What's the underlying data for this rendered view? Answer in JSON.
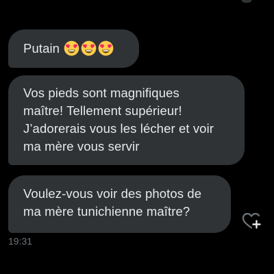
{
  "messages": [
    {
      "text": "Putain",
      "emojis": [
        "heart-eyes-emoji",
        "heart-eyes-emoji",
        "heart-eyes-emoji"
      ]
    },
    {
      "lines": [
        "Vos pieds sont magnifiques",
        "maître! Tellement supérieur!",
        "J’adorerais vous les lécher et voir",
        "ma mère vous servir"
      ]
    },
    {
      "lines": [
        "Voulez-vous voir des photos de",
        "ma mère tunichienne maître?"
      ]
    }
  ],
  "timestamp": "19:31",
  "icons": {
    "react": "heart-plus-icon"
  },
  "colors": {
    "background": "#000000",
    "bubble": "#2f3336",
    "text": "#e7e9ea",
    "muted": "#71767b",
    "emoji_face": "#ffcc4d",
    "emoji_heart": "#f4245e"
  }
}
